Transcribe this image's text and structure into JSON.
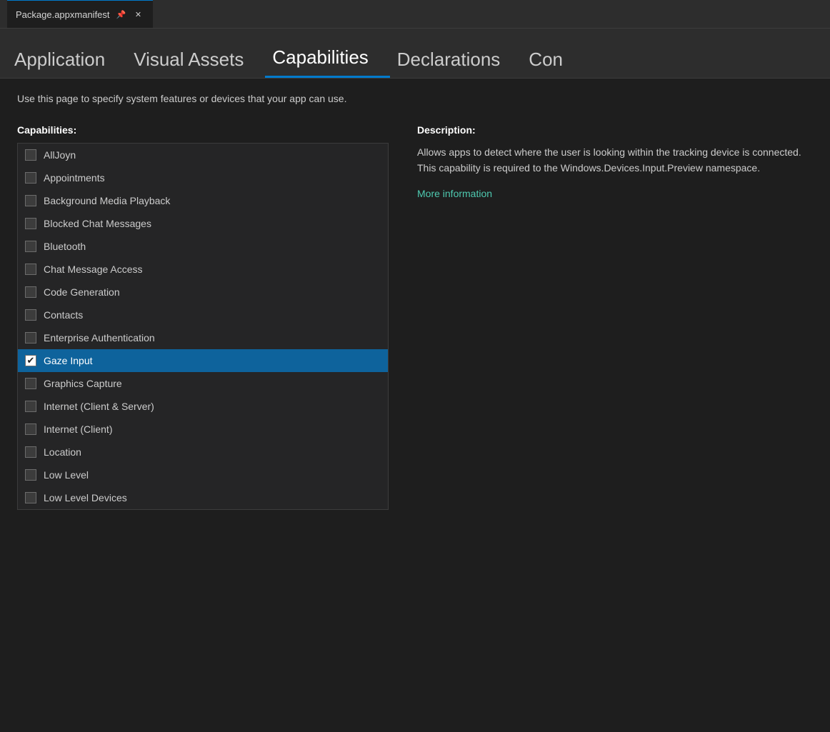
{
  "titleBar": {
    "fileName": "Package.appxmanifest",
    "pinLabel": "📌",
    "closeLabel": "✕"
  },
  "navTabs": [
    {
      "id": "application",
      "label": "Application",
      "active": false
    },
    {
      "id": "visual-assets",
      "label": "Visual Assets",
      "active": false
    },
    {
      "id": "capabilities",
      "label": "Capabilities",
      "active": true
    },
    {
      "id": "declarations",
      "label": "Declarations",
      "active": false
    },
    {
      "id": "con",
      "label": "Con",
      "active": false
    }
  ],
  "pageDescription": "Use this page to specify system features or devices that your app can use.",
  "capabilitiesSection": {
    "label": "Capabilities:",
    "items": [
      {
        "id": "alljoyn",
        "label": "AllJoyn",
        "checked": false,
        "selected": false
      },
      {
        "id": "appointments",
        "label": "Appointments",
        "checked": false,
        "selected": false
      },
      {
        "id": "background-media-playback",
        "label": "Background Media Playback",
        "checked": false,
        "selected": false
      },
      {
        "id": "blocked-chat-messages",
        "label": "Blocked Chat Messages",
        "checked": false,
        "selected": false
      },
      {
        "id": "bluetooth",
        "label": "Bluetooth",
        "checked": false,
        "selected": false
      },
      {
        "id": "chat-message-access",
        "label": "Chat Message Access",
        "checked": false,
        "selected": false
      },
      {
        "id": "code-generation",
        "label": "Code Generation",
        "checked": false,
        "selected": false
      },
      {
        "id": "contacts",
        "label": "Contacts",
        "checked": false,
        "selected": false
      },
      {
        "id": "enterprise-authentication",
        "label": "Enterprise Authentication",
        "checked": false,
        "selected": false
      },
      {
        "id": "gaze-input",
        "label": "Gaze Input",
        "checked": true,
        "selected": true
      },
      {
        "id": "graphics-capture",
        "label": "Graphics Capture",
        "checked": false,
        "selected": false
      },
      {
        "id": "internet-client-server",
        "label": "Internet (Client & Server)",
        "checked": false,
        "selected": false
      },
      {
        "id": "internet-client",
        "label": "Internet (Client)",
        "checked": false,
        "selected": false
      },
      {
        "id": "location",
        "label": "Location",
        "checked": false,
        "selected": false
      },
      {
        "id": "low-level",
        "label": "Low Level",
        "checked": false,
        "selected": false
      },
      {
        "id": "low-level-devices",
        "label": "Low Level Devices",
        "checked": false,
        "selected": false
      }
    ]
  },
  "descriptionSection": {
    "label": "Description:",
    "text": "Allows apps to detect where the user is looking within the tracking device is connected. This capability is required to the Windows.Devices.Input.Preview namespace.",
    "moreInfoLabel": "More information"
  }
}
